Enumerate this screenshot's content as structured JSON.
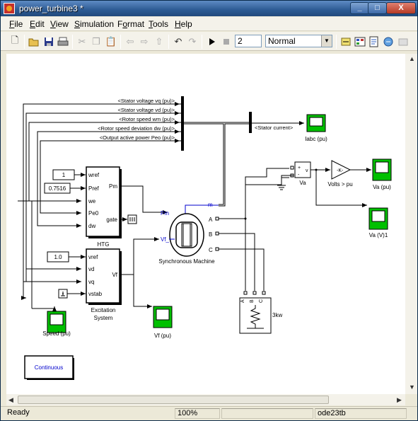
{
  "window": {
    "title": "power_turbine3 *",
    "minimize": "_",
    "maximize": "□",
    "close": "X"
  },
  "menu": {
    "items": [
      {
        "key": "F",
        "rest": "ile"
      },
      {
        "key": "E",
        "rest": "dit"
      },
      {
        "key": "V",
        "rest": "iew"
      },
      {
        "key": "S",
        "rest": "imulation"
      },
      {
        "key": "",
        "pre": "F",
        "mid": "o",
        "rest": "rmat"
      },
      {
        "key": "T",
        "rest": "ools"
      },
      {
        "key": "H",
        "rest": "elp"
      }
    ]
  },
  "toolbar": {
    "stop_time": "2",
    "sim_mode": "Normal",
    "icons": [
      "new-icon",
      "open-icon",
      "save-icon",
      "print-icon",
      "cut-icon",
      "copy-icon",
      "paste-icon",
      "back-icon",
      "forward-icon",
      "up-icon",
      "undo-icon",
      "redo-icon",
      "run-icon",
      "stop-icon",
      "build-icon",
      "library-icon",
      "explorer-icon",
      "debugger-icon",
      "blocks-icon"
    ]
  },
  "diagram": {
    "bus_labels": [
      "<Stator voltage  vq  (pu)>",
      "<Stator voltage  vd  (pu)>",
      "<Rotor speed  wm  (pu)>",
      "<Rotor speed deviation  dw (pu)>",
      "<Output active power   Peo (pu)>"
    ],
    "stator_current_label": "<Stator current>",
    "scope_iabc": "Iabc (pu)",
    "const_wref": "1",
    "const_pref": "0.7516",
    "const_vref": "1.0",
    "htg": {
      "name": "HTG",
      "inputs": [
        "wref",
        "Pref",
        "we",
        "Pe0",
        "dw"
      ],
      "outputs": [
        "Pm",
        "gate"
      ]
    },
    "excitation": {
      "name_line1": "Excitation",
      "name_line2": "System",
      "inputs": [
        "vref",
        "vd",
        "vq",
        "vstab"
      ],
      "outputs": [
        "Vf"
      ]
    },
    "machine": {
      "name": "Synchronous Machine",
      "ports_in": [
        "Pm",
        "Vf_"
      ],
      "ports_out": [
        "m",
        "A",
        "B",
        "C"
      ]
    },
    "voltmeter": {
      "name": "Va",
      "plus": "+",
      "minus": "-",
      "out": "v"
    },
    "gain": {
      "value": "-K-",
      "name": "Volts > pu"
    },
    "scope_va_pu": "Va (pu)",
    "scope_va_v": "Va (V)1",
    "scope_speed": "Speed (pu)",
    "scope_vf": "Vf (pu)",
    "load": {
      "name": "3kw",
      "ports": [
        "A",
        "B",
        "C"
      ]
    },
    "powergui": "Continuous"
  },
  "status": {
    "state": "Ready",
    "zoom": "100%",
    "solver": "ode23tb"
  }
}
